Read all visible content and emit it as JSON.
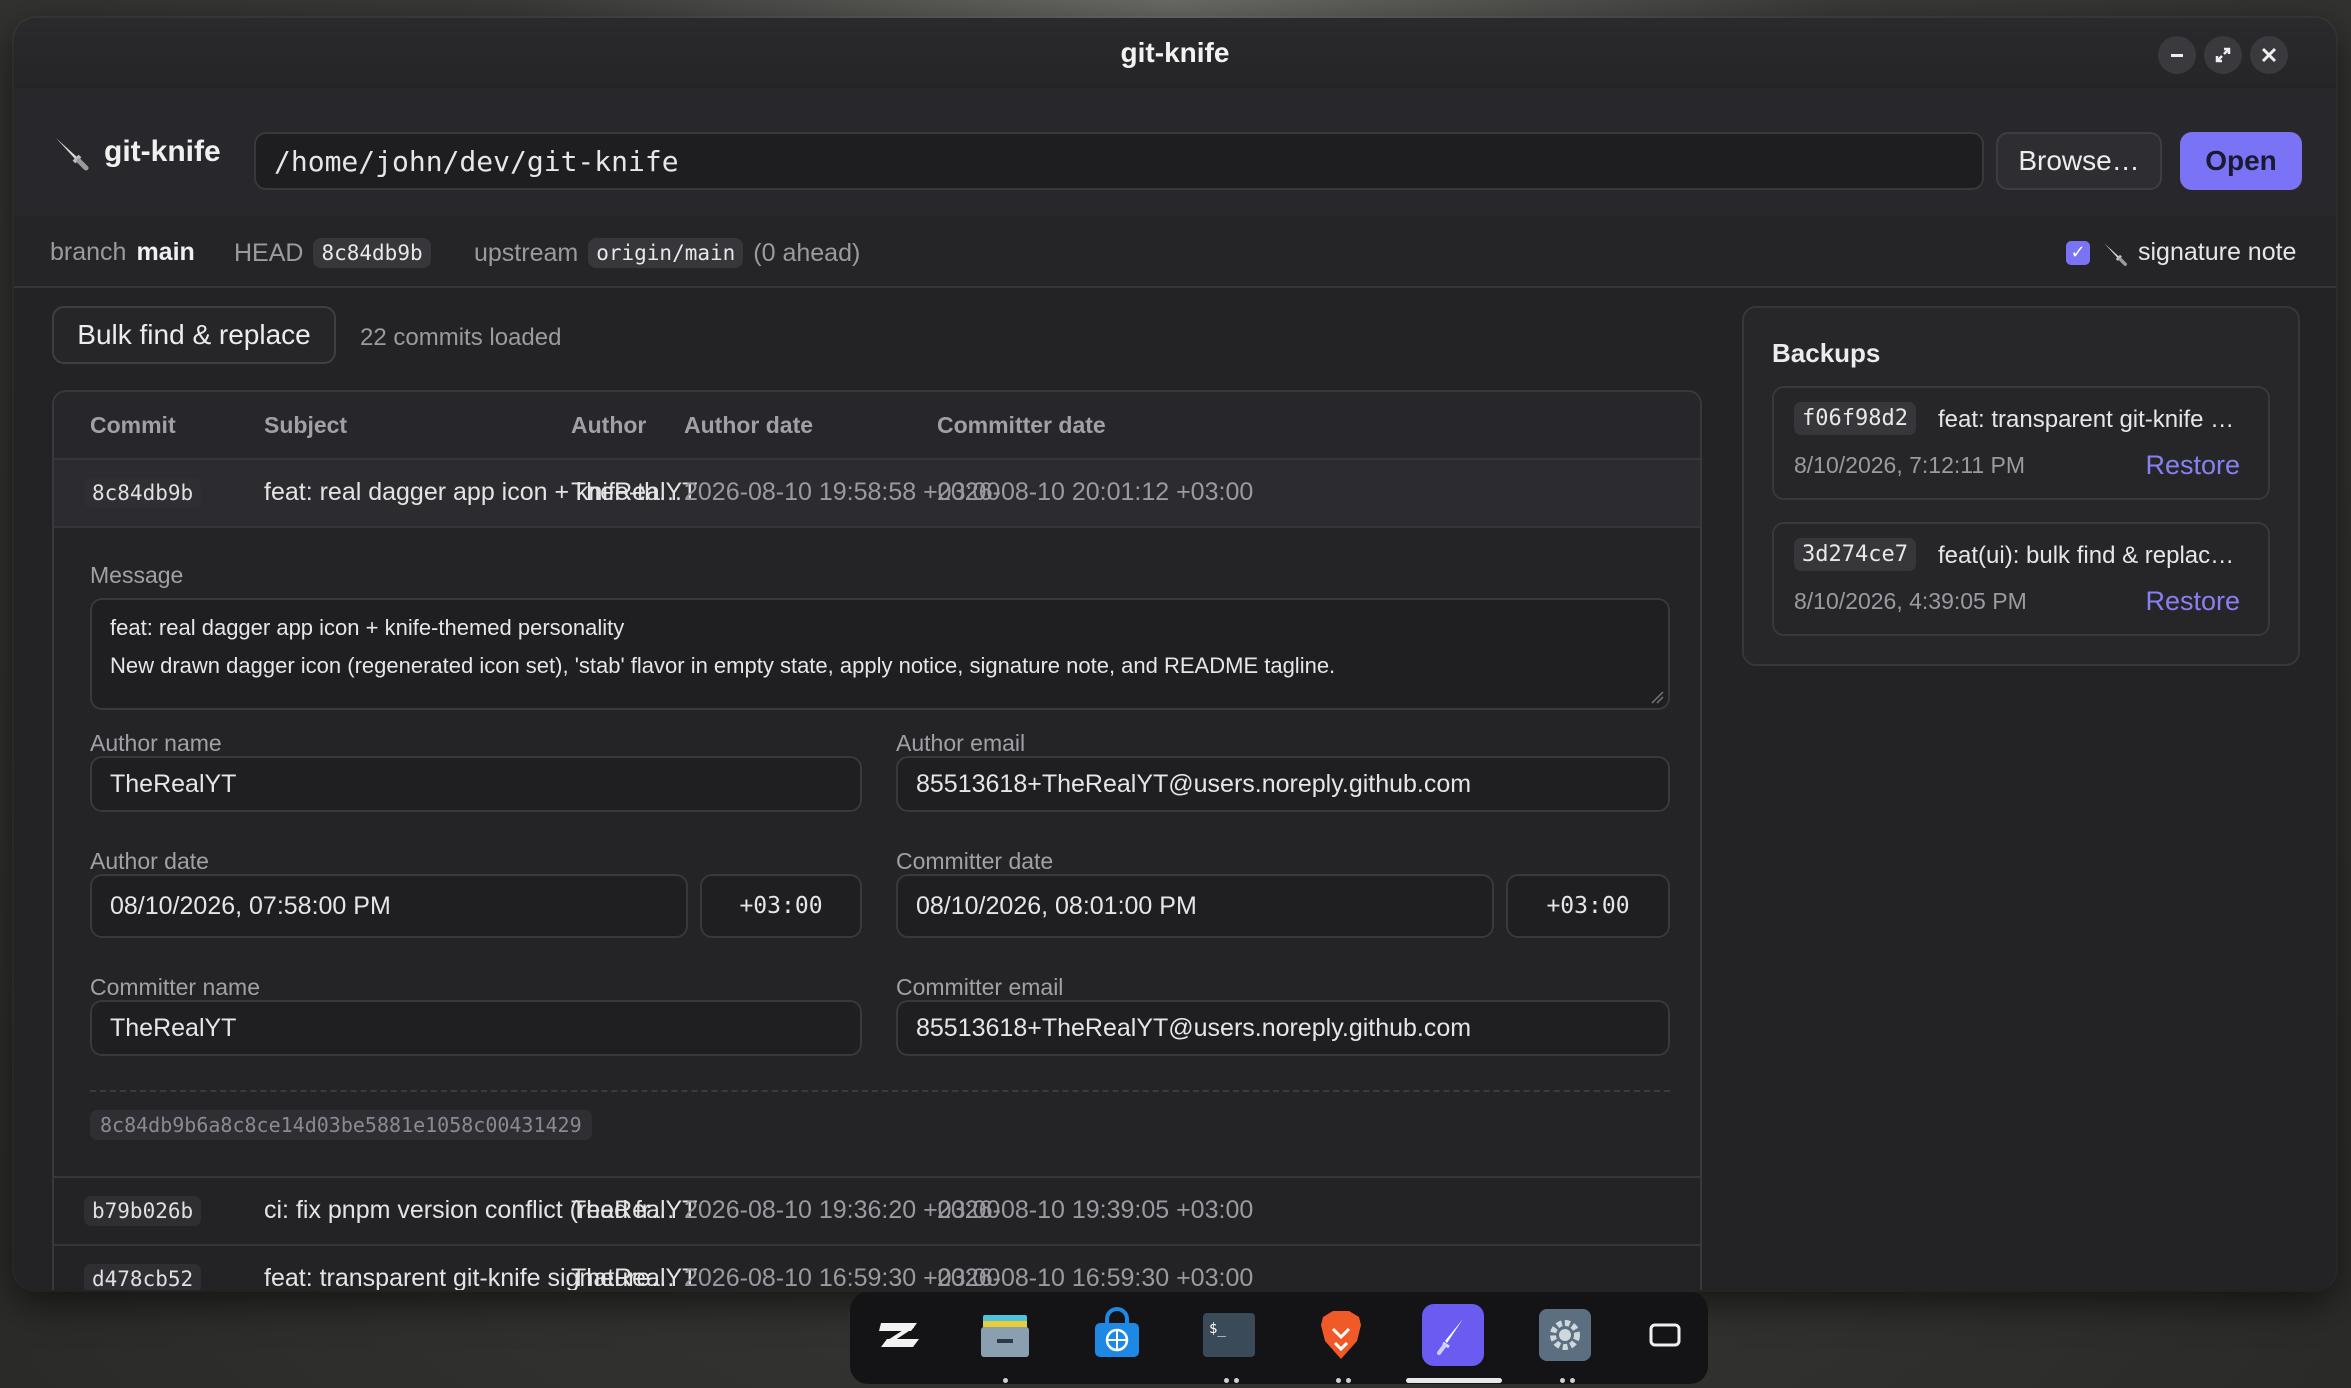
{
  "window": {
    "title": "git-knife"
  },
  "toolbar": {
    "brand": "git-knife",
    "path_value": "/home/john/dev/git-knife",
    "browse_label": "Browse…",
    "open_label": "Open"
  },
  "info": {
    "branch_label": "branch",
    "branch": "main",
    "head_label": "HEAD",
    "head": "8c84db9b",
    "upstream_label": "upstream",
    "upstream": "origin/main",
    "ahead": "(0 ahead)",
    "signature_label": "signature note",
    "signature_checked": true
  },
  "main": {
    "bulk_label": "Bulk find & replace",
    "loaded": "22 commits loaded",
    "columns": [
      "Commit",
      "Subject",
      "Author",
      "Author date",
      "Committer date"
    ],
    "commits": [
      {
        "hash": "8c84db9b",
        "subject": "feat: real dagger app icon + knife-th…",
        "author": "TheRealYT",
        "author_date": "2026-08-10 19:58:58 +03:00",
        "committer_date": "2026-08-10 20:01:12 +03:00"
      },
      {
        "hash": "b79b026b",
        "subject": "ci: fix pnpm version conflict (read fr…",
        "author": "TheRealYT",
        "author_date": "2026-08-10 19:36:20 +03:00",
        "committer_date": "2026-08-10 19:39:05 +03:00"
      },
      {
        "hash": "d478cb52",
        "subject": "feat: transparent git-knife signature…",
        "author": "TheRealYT",
        "author_date": "2026-08-10 16:59:30 +03:00",
        "committer_date": "2026-08-10 16:59:30 +03:00"
      }
    ]
  },
  "detail": {
    "message_label": "Message",
    "message_line1": "feat: real dagger app icon + knife-themed personality",
    "message_line2": "New drawn dagger icon (regenerated icon set), 'stab' flavor in empty state, apply notice, signature note, and README tagline.",
    "author_name_label": "Author name",
    "author_name": "TheRealYT",
    "author_email_label": "Author email",
    "author_email": "85513618+TheRealYT@users.noreply.github.com",
    "author_date_label": "Author date",
    "author_date": "08/10/2026, 07:58:00 PM",
    "author_tz": "+03:00",
    "committer_date_label": "Committer date",
    "committer_date": "08/10/2026, 08:01:00 PM",
    "committer_tz": "+03:00",
    "committer_name_label": "Committer name",
    "committer_name": "TheRealYT",
    "committer_email_label": "Committer email",
    "committer_email": "85513618+TheRealYT@users.noreply.github.com",
    "full_hash": "8c84db9b6a8c8ce14d03be5881e1058c00431429"
  },
  "backups": {
    "title": "Backups",
    "items": [
      {
        "hash": "f06f98d2",
        "subject": "feat: transparent git-knife …",
        "when": "8/10/2026, 7:12:11 PM",
        "restore": "Restore"
      },
      {
        "hash": "3d274ce7",
        "subject": "feat(ui): bulk find & replac…",
        "when": "8/10/2026, 4:39:05 PM",
        "restore": "Restore"
      }
    ]
  },
  "colors": {
    "accent": "#7b73f5",
    "link": "#8880f2"
  },
  "dock": [
    "zorin-menu-icon",
    "files-icon",
    "software-store-icon",
    "terminal-icon",
    "brave-browser-icon",
    "git-knife-icon",
    "settings-icon",
    "workspaces-icon"
  ]
}
